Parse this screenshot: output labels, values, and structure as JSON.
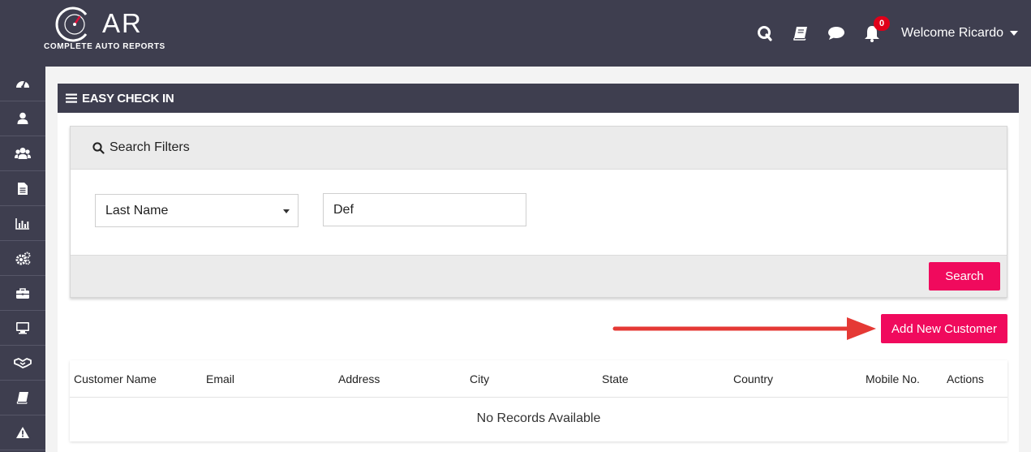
{
  "app": {
    "logo_text": "AR",
    "logo_subtitle": "COMPLETE AUTO REPORTS"
  },
  "header": {
    "icons": [
      "quickbooks-icon",
      "book-icon",
      "chat-icon",
      "bell-icon"
    ],
    "notification_count": "0",
    "welcome": "Welcome Ricardo"
  },
  "sidebar": {
    "items": [
      {
        "icon": "dashboard-icon"
      },
      {
        "icon": "user-icon"
      },
      {
        "icon": "users-icon"
      },
      {
        "icon": "document-icon"
      },
      {
        "icon": "bar-chart-icon"
      },
      {
        "icon": "gears-icon"
      },
      {
        "icon": "briefcase-icon"
      },
      {
        "icon": "monitor-icon"
      },
      {
        "icon": "handshake-icon"
      },
      {
        "icon": "book-icon"
      },
      {
        "icon": "warning-icon"
      }
    ]
  },
  "page": {
    "title": "EASY CHECK IN"
  },
  "filters": {
    "title": "Search Filters",
    "field_select": "Last Name",
    "search_value": "Def",
    "search_button": "Search"
  },
  "actions": {
    "add_customer": "Add New Customer"
  },
  "table": {
    "columns": [
      "Customer Name",
      "Email",
      "Address",
      "City",
      "State",
      "Country",
      "Mobile No.",
      "Actions"
    ],
    "empty_message": "No Records Available"
  },
  "colors": {
    "header_bg": "#3e3e4f",
    "accent": "#f00a5d",
    "arrow": "#e53935",
    "badge": "#e0001a"
  }
}
